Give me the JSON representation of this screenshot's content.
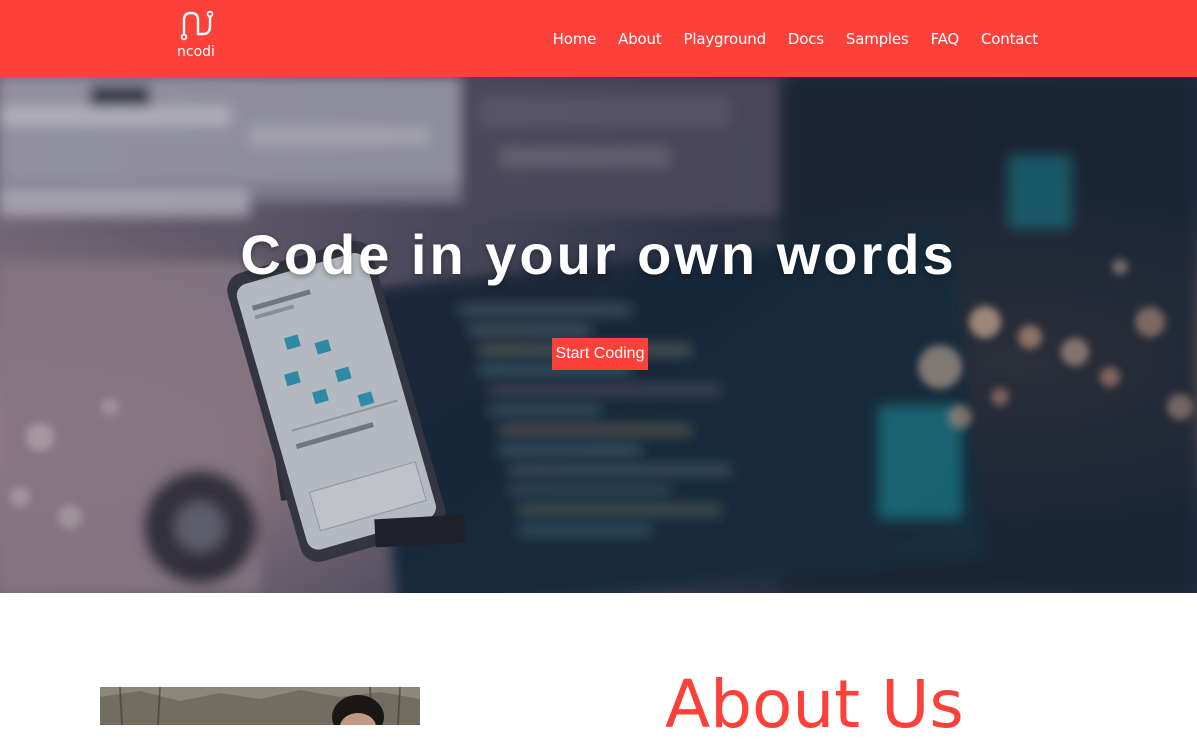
{
  "header": {
    "background_color": "#fc413a",
    "logo": {
      "text": "ncodi",
      "icon": "ncodi-logo-icon"
    },
    "nav": [
      {
        "label": "Home"
      },
      {
        "label": "About"
      },
      {
        "label": "Playground"
      },
      {
        "label": "Docs"
      },
      {
        "label": "Samples"
      },
      {
        "label": "FAQ"
      },
      {
        "label": "Contact"
      }
    ]
  },
  "hero": {
    "title": "Code in your own words",
    "cta_label": "Start Coding",
    "background_image": "desk-with-phone-and-code-monitor-photo"
  },
  "about": {
    "title": "About Us",
    "title_color": "#fc413a",
    "photo": "person-outdoors-photo"
  }
}
